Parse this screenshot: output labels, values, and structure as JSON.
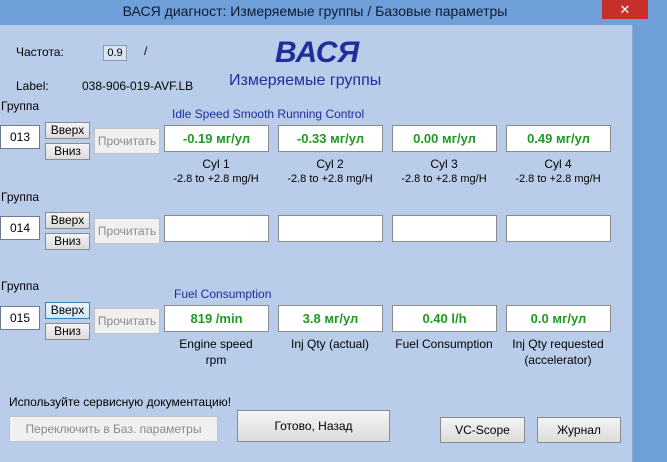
{
  "window": {
    "title": "ВАСЯ диагност: Измеряемые группы / Базовые параметры",
    "close_symbol": "✕"
  },
  "header": {
    "freq_label": "Частота:",
    "freq_value": "0.9",
    "freq_slash": "/",
    "label_label": "Label:",
    "label_value": "038-906-019-AVF.LB",
    "brand": "ВАСЯ",
    "subtitle": "Измеряемые группы"
  },
  "groups": [
    {
      "group_label": "Группа",
      "number": "013",
      "up_label": "Вверх",
      "down_label": "Вниз",
      "read_label": "Прочитать",
      "section_title": "Idle Speed Smooth Running Control",
      "fields": [
        {
          "value": "-0.19 мг/ул",
          "name": "Cyl 1",
          "range": "-2.8 to +2.8 mg/H"
        },
        {
          "value": "-0.33 мг/ул",
          "name": "Cyl 2",
          "range": "-2.8 to +2.8 mg/H"
        },
        {
          "value": "0.00 мг/ул",
          "name": "Cyl 3",
          "range": "-2.8 to +2.8 mg/H"
        },
        {
          "value": "0.49 мг/ул",
          "name": "Cyl 4",
          "range": "-2.8 to +2.8 mg/H"
        }
      ]
    },
    {
      "group_label": "Группа",
      "number": "014",
      "up_label": "Вверх",
      "down_label": "Вниз",
      "read_label": "Прочитать",
      "section_title": "",
      "fields": [
        {
          "value": "",
          "name": "",
          "range": ""
        },
        {
          "value": "",
          "name": "",
          "range": ""
        },
        {
          "value": "",
          "name": "",
          "range": ""
        },
        {
          "value": "",
          "name": "",
          "range": ""
        }
      ]
    },
    {
      "group_label": "Группа",
      "number": "015",
      "up_label": "Вверх",
      "down_label": "Вниз",
      "read_label": "Прочитать",
      "section_title": "Fuel Consumption",
      "fields": [
        {
          "value": "819 /min",
          "name_line1": "Engine speed",
          "name_line2": "rpm"
        },
        {
          "value": "3.8 мг/ул",
          "name_line1": "Inj Qty (actual)",
          "name_line2": ""
        },
        {
          "value": "0.40 l/h",
          "name_line1": "Fuel Consumption",
          "name_line2": ""
        },
        {
          "value": "0.0 мг/ул",
          "name_line1": "Inj Qty requested",
          "name_line2": "(accelerator)"
        }
      ]
    }
  ],
  "footer": {
    "hint": "Используйте сервисную документацию!",
    "switch_label": "Переключить в Баз. параметры",
    "done_label": "Готово, Назад",
    "vcscope_label": "VC-Scope",
    "journal_label": "Журнал"
  }
}
